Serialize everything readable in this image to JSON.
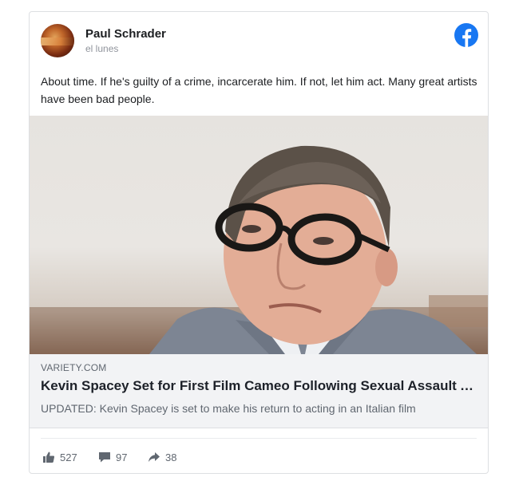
{
  "post": {
    "author": "Paul Schrader",
    "time": "el lunes",
    "text": "About time. If he's guilty of a crime, incarcerate him. If not, let him act. Many great artists have been bad people.",
    "brand_color": "#1877f2"
  },
  "link": {
    "domain": "VARIETY.COM",
    "headline": "Kevin Spacey Set for First Film Cameo Following Sexual Assault Allegations",
    "description": "UPDATED: Kevin Spacey is set to make his return to acting in an Italian film"
  },
  "stats": {
    "likes": "527",
    "comments": "97",
    "shares": "38"
  },
  "icons": {
    "platform": "facebook-logo-icon",
    "likes": "thumbs-up-icon",
    "comments": "comment-icon",
    "shares": "share-arrow-icon"
  }
}
